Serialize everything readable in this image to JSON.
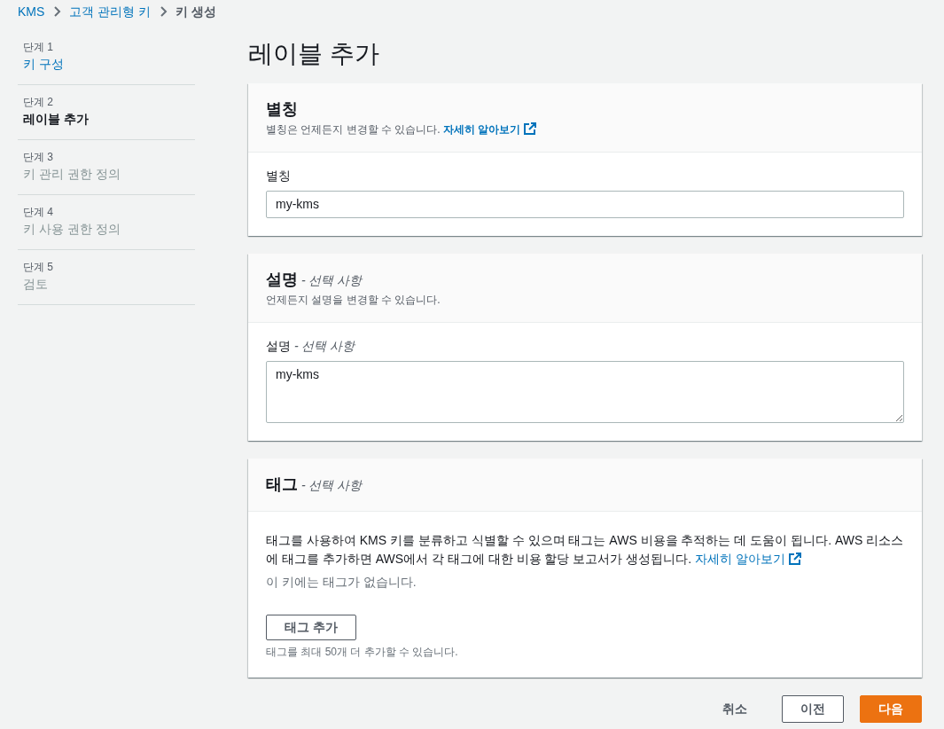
{
  "breadcrumb": [
    {
      "label": "KMS",
      "link": true
    },
    {
      "label": "고객 관리형 키",
      "link": true
    },
    {
      "label": "키 생성",
      "link": false
    }
  ],
  "steps": [
    {
      "step": "단계 1",
      "label": "키 구성",
      "selected": false,
      "disabled": false
    },
    {
      "step": "단계 2",
      "label": "레이블 추가",
      "selected": true,
      "disabled": false
    },
    {
      "step": "단계 3",
      "label": "키 관리 권한 정의",
      "selected": false,
      "disabled": true
    },
    {
      "step": "단계 4",
      "label": "키 사용 권한 정의",
      "selected": false,
      "disabled": true
    },
    {
      "step": "단계 5",
      "label": "검토",
      "selected": false,
      "disabled": true
    }
  ],
  "page_title": "레이블 추가",
  "sections": [
    {
      "title": "별칭",
      "description": "별칭은 언제든지 변경할 수 있습니다.",
      "link": "자세히 알아보기",
      "body": [
        {
          "kind": "field",
          "label": "별칭",
          "value": "my-kms"
        }
      ]
    },
    {
      "title": "설명",
      "title_suffix": "- 선택 사항",
      "description": "언제든지 설명을 변경할 수 있습니다.",
      "body": [
        {
          "kind": "textarea",
          "label": "설명",
          "label_suffix": "- 선택 사항",
          "value": "my-kms"
        }
      ]
    },
    {
      "title": "태그",
      "title_suffix": "- 선택 사항",
      "body": [
        {
          "kind": "paragraph",
          "text": "태그를 사용하여 KMS 키를 분류하고 식별할 수 있으며 태그는 AWS 비용을 추적하는 데 도움이 됩니다. AWS 리소스에 태그를 추가하면 AWS에서 각 태그에 대한 비용 할당 보고서가 생성됩니다.",
          "link": "자세히 알아보기"
        },
        {
          "kind": "note",
          "text": "이 키에는 태그가 없습니다."
        },
        {
          "kind": "button",
          "label": "태그 추가"
        },
        {
          "kind": "hint",
          "text": "태그를 최대 50개 더 추가할 수 있습니다."
        }
      ]
    }
  ],
  "actions": [
    {
      "label": "취소",
      "kind": "link"
    },
    {
      "label": "이전",
      "kind": "secondary"
    },
    {
      "label": "다음",
      "kind": "primary"
    }
  ]
}
